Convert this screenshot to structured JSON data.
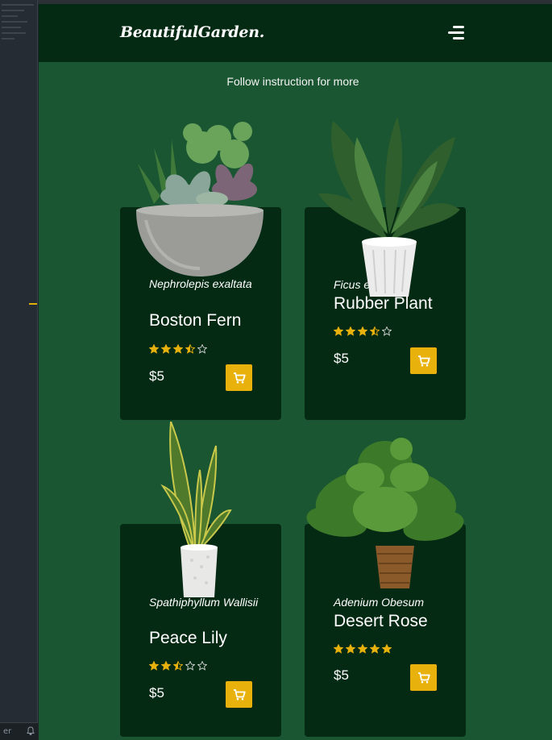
{
  "site": {
    "logo": "BeautifulGarden.",
    "subtitle": "Follow instruction for more"
  },
  "editor": {
    "status_text": "er"
  },
  "colors": {
    "page_bg": "#1a5632",
    "header_bg": "#052a14",
    "card_bg": "#052a14",
    "accent": "#e8b10c"
  },
  "products": [
    {
      "latin": "Nephrolepis exaltata",
      "name": "Boston Fern",
      "rating": 3.5,
      "price": "$5"
    },
    {
      "latin": "Ficus elastica",
      "name": "Rubber Plant",
      "rating": 3.5,
      "price": "$5"
    },
    {
      "latin": "Spathiphyllum Wallisii",
      "name": "Peace Lily",
      "rating": 2.5,
      "price": "$5"
    },
    {
      "latin": "Adenium Obesum",
      "name": "Desert Rose",
      "rating": 5,
      "price": "$5"
    }
  ]
}
